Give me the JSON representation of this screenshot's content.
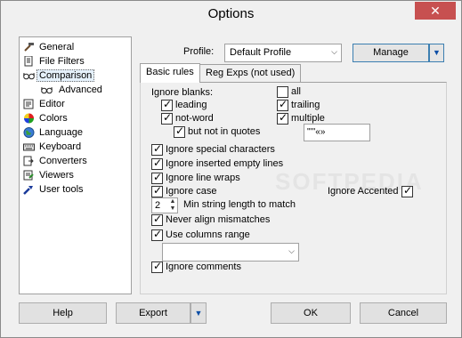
{
  "window": {
    "title": "Options",
    "close_glyph": "✕"
  },
  "nav": {
    "items": [
      {
        "label": "General",
        "icon": "hammer-icon"
      },
      {
        "label": "File Filters",
        "icon": "file-filter-icon"
      },
      {
        "label": "Comparison",
        "icon": "glasses-icon",
        "selected": true
      },
      {
        "label": "Advanced",
        "icon": "glasses-icon",
        "sub": true
      },
      {
        "label": "Editor",
        "icon": "editor-icon"
      },
      {
        "label": "Colors",
        "icon": "color-wheel-icon"
      },
      {
        "label": "Language",
        "icon": "globe-icon"
      },
      {
        "label": "Keyboard",
        "icon": "keyboard-icon"
      },
      {
        "label": "Converters",
        "icon": "converter-icon"
      },
      {
        "label": "Viewers",
        "icon": "viewer-icon"
      },
      {
        "label": "User tools",
        "icon": "wrench-icon"
      }
    ]
  },
  "profile": {
    "label": "Profile:",
    "value": "Default Profile",
    "manage_label": "Manage"
  },
  "tabs": [
    {
      "label": "Basic rules",
      "active": true
    },
    {
      "label": "Reg Exps (not used)",
      "active": false
    }
  ],
  "basic_rules": {
    "ignore_blanks_label": "Ignore blanks:",
    "leading": {
      "label": "leading",
      "checked": true
    },
    "not_word": {
      "label": "not-word",
      "checked": true
    },
    "but_not_in_quotes": {
      "label": "but not in quotes",
      "checked": true
    },
    "all": {
      "label": "all",
      "checked": false
    },
    "trailing": {
      "label": "trailing",
      "checked": true
    },
    "multiple": {
      "label": "multiple",
      "checked": true
    },
    "quote_chars": "\"'''«»",
    "ignore_special_characters": {
      "label": "Ignore special characters",
      "checked": true
    },
    "ignore_inserted_empty_lines": {
      "label": "Ignore inserted empty lines",
      "checked": true
    },
    "ignore_line_wraps": {
      "label": "Ignore line wraps",
      "checked": true
    },
    "ignore_case": {
      "label": "Ignore case",
      "checked": true
    },
    "ignore_accented": {
      "label": "Ignore Accented",
      "checked": true
    },
    "min_string_length": {
      "value": "2",
      "label": "Min string length to match"
    },
    "never_align_mismatches": {
      "label": "Never align mismatches",
      "checked": true
    },
    "use_columns_range": {
      "label": "Use columns range",
      "checked": true
    },
    "columns_range_value": "",
    "ignore_comments": {
      "label": "Ignore comments",
      "checked": true
    }
  },
  "buttons": {
    "help": "Help",
    "export": "Export",
    "ok": "OK",
    "cancel": "Cancel"
  },
  "watermark": "SOFTPEDIA"
}
